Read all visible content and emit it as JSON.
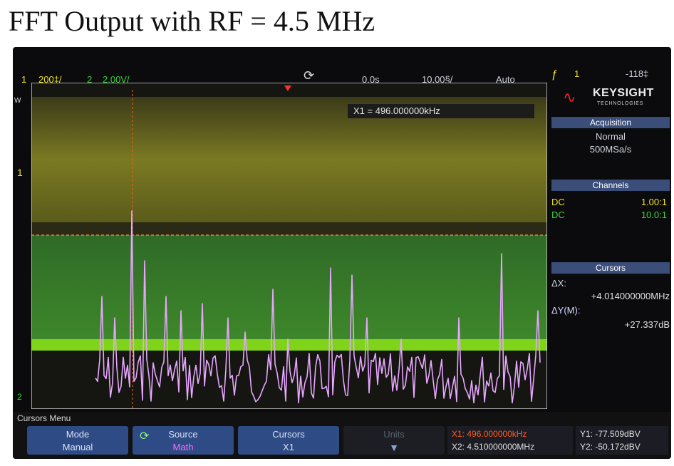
{
  "page": {
    "title": "FFT Output with RF = 4.5 MHz"
  },
  "topbar": {
    "ch1_number": "1",
    "ch1_scale": "200‡/",
    "ch2_number": "2",
    "ch2_scale": "2.00V/",
    "run_icon": "refresh-icon",
    "delay": "0.0s",
    "timebase": "10.00§/",
    "trigger_mode": "Auto",
    "trigger_symbol": "ƒ",
    "trigger_source": "1",
    "trigger_level": "-118‡"
  },
  "display": {
    "cursor_x1_readout": "X1 = 496.000000kHz",
    "label_w": "W",
    "label_ch1": "1",
    "label_ch2": "2",
    "colors": {
      "ch1": "#f0e11e",
      "ch2": "#35d136",
      "math": "#e7a6ff",
      "cursor": "#ff5a1c"
    }
  },
  "brand": {
    "name": "KEYSIGHT",
    "sub": "TECHNOLOGIES"
  },
  "acquisition": {
    "header": "Acquisition",
    "mode": "Normal",
    "rate": "500MSa/s"
  },
  "channels": {
    "header": "Channels",
    "rows": [
      {
        "coupling": "DC",
        "probe": "1.00:1",
        "color": "#f0e11e"
      },
      {
        "coupling": "DC",
        "probe": "10.0:1",
        "color": "#35d136"
      }
    ]
  },
  "cursors": {
    "header": "Cursors",
    "dx_label": "ΔX:",
    "dx_value": "+4.014000000MHz",
    "dy_label": "ΔY(M):",
    "dy_value": "+27.337dB"
  },
  "menu": {
    "title": "Cursors Menu",
    "softkeys": [
      {
        "title": "Mode",
        "value": "Manual"
      },
      {
        "title": "Source",
        "value": "Math"
      },
      {
        "title": "Cursors",
        "value": "X1"
      },
      {
        "title": "Units",
        "value": ""
      }
    ]
  },
  "readout": {
    "x1": "X1: 496.000000kHz",
    "x2": "X2: 4.510000000MHz",
    "y1": "Y1: -77.509dBV",
    "y2": "Y2: -50.172dBV"
  }
}
